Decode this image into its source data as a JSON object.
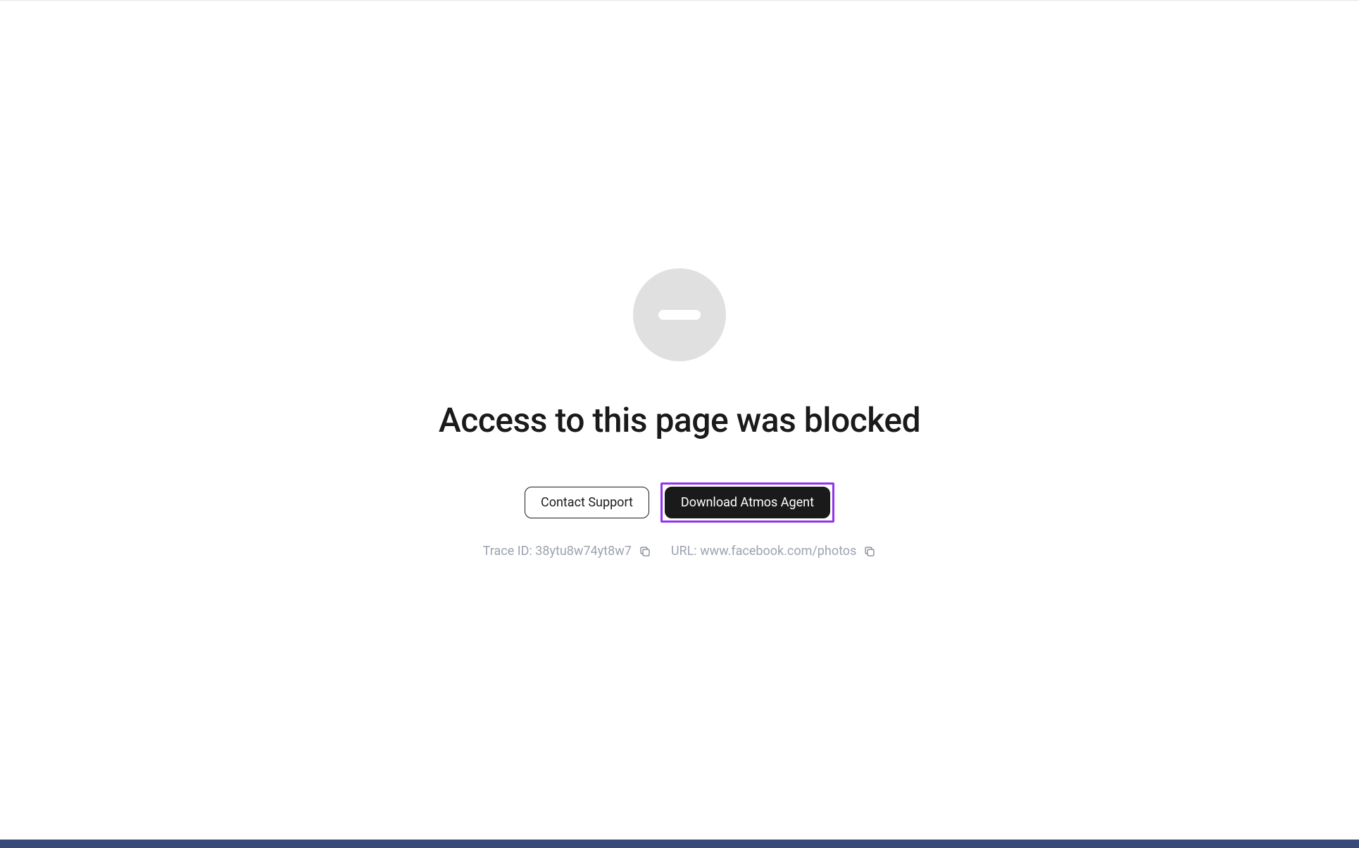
{
  "heading": "Access to this page was blocked",
  "buttons": {
    "contact_support": "Contact Support",
    "download_agent": "Download Atmos Agent"
  },
  "info": {
    "trace_label": "Trace ID: ",
    "trace_value": "38ytu8w74yt8w7",
    "url_label": "URL: ",
    "url_value": "www.facebook.com/photos"
  },
  "icon_name": "blocked-icon",
  "colors": {
    "highlight": "#9333ea",
    "bottom_bar": "#374a7a",
    "icon_bg": "#e0e0e0",
    "text_muted": "#9ca3af",
    "text_dark": "#1a1a1a"
  }
}
